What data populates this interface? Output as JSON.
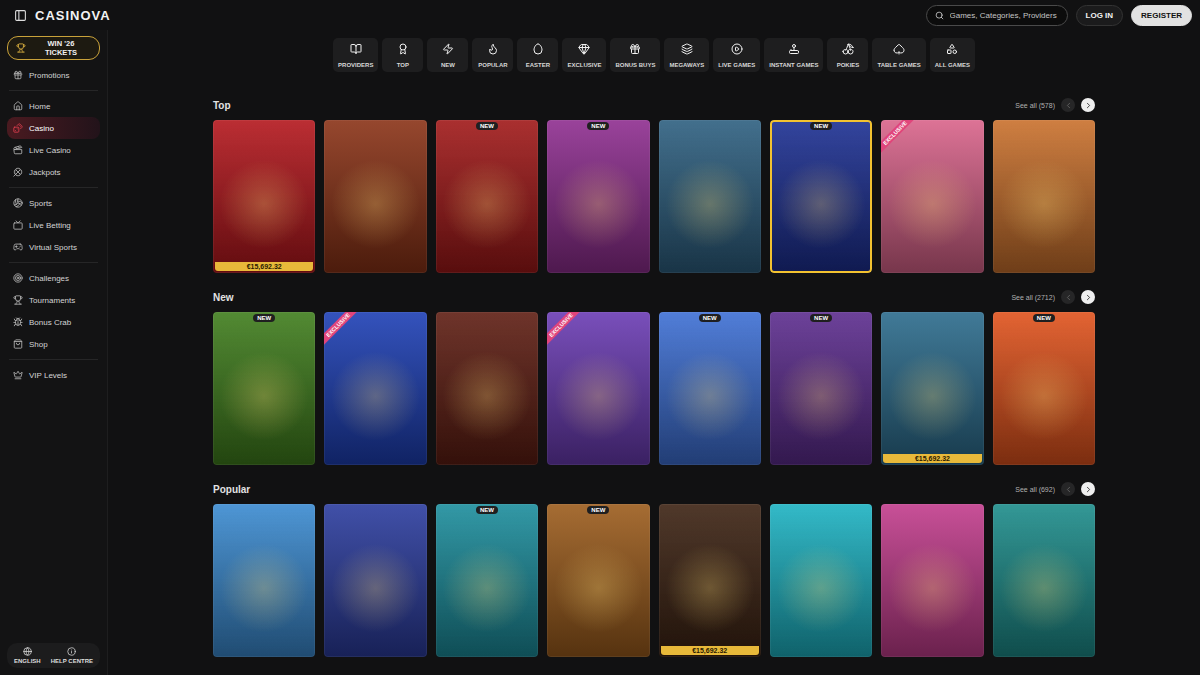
{
  "header": {
    "logo": "CASINOVA",
    "search": {
      "placeholder": "Games, Categories, Providers"
    },
    "buttons": [
      {
        "label": "LOG IN",
        "kind": "secondary"
      },
      {
        "label": "REGISTER",
        "kind": "primary"
      }
    ]
  },
  "sidebar": {
    "promo": "WIN '26 TICKETS",
    "groups": [
      [
        {
          "label": "Promotions",
          "selected": false
        }
      ],
      [
        {
          "label": "Home",
          "selected": false
        },
        {
          "label": "Casino",
          "selected": true
        },
        {
          "label": "Live Casino",
          "selected": false
        },
        {
          "label": "Jackpots",
          "selected": false
        }
      ],
      [
        {
          "label": "Sports",
          "selected": false
        },
        {
          "label": "Live Betting",
          "selected": false
        },
        {
          "label": "Virtual Sports",
          "selected": false
        }
      ],
      [
        {
          "label": "Challenges",
          "selected": false
        },
        {
          "label": "Tournaments",
          "selected": false
        },
        {
          "label": "Bonus Crab",
          "selected": false
        },
        {
          "label": "Shop",
          "selected": false
        }
      ],
      [
        {
          "label": "VIP Levels",
          "selected": false
        }
      ]
    ],
    "footer": [
      "ENGLISH",
      "HELP CENTRE"
    ]
  },
  "categories": [
    {
      "label": "PROVIDERS",
      "selected": false
    },
    {
      "label": "TOP",
      "selected": false
    },
    {
      "label": "NEW",
      "selected": false
    },
    {
      "label": "POPULAR",
      "selected": false
    },
    {
      "label": "EASTER",
      "selected": false
    },
    {
      "label": "EXCLUSIVE",
      "selected": false
    },
    {
      "label": "BONUS BUYS",
      "selected": false
    },
    {
      "label": "MEGAWAYS",
      "selected": false
    },
    {
      "label": "LIVE GAMES",
      "selected": false
    },
    {
      "label": "INSTANT GAMES",
      "selected": false
    },
    {
      "label": "POKIES",
      "selected": false
    },
    {
      "label": "TABLE GAMES",
      "selected": false
    },
    {
      "label": "ALL GAMES",
      "selected": false
    }
  ],
  "sections": [
    {
      "title": "Top",
      "see_all": "See all (578)",
      "prev_enabled": false,
      "next_enabled": true,
      "games": [
        {
          "color": "#b3161c",
          "selected": false,
          "badges": [
            {
              "kind": "jackpot",
              "text": "€15,692.32"
            }
          ]
        },
        {
          "color": "#8a3216",
          "selected": false,
          "badges": []
        },
        {
          "color": "#a01818",
          "selected": false,
          "badges": [
            {
              "kind": "new",
              "text": "NEW"
            }
          ]
        },
        {
          "color": "#8e2d8f",
          "selected": false,
          "badges": [
            {
              "kind": "new",
              "text": "NEW"
            }
          ]
        },
        {
          "color": "#2d5f80",
          "selected": false,
          "badges": []
        },
        {
          "color": "#1c2f92",
          "selected": true,
          "badges": [
            {
              "kind": "new",
              "text": "NEW"
            }
          ]
        },
        {
          "color": "#d9638a",
          "selected": false,
          "badges": [
            {
              "kind": "exclusive",
              "text": "EXCLUSIVE"
            }
          ]
        },
        {
          "color": "#c9702c",
          "selected": false,
          "badges": []
        }
      ]
    },
    {
      "title": "New",
      "see_all": "See all (2712)",
      "prev_enabled": false,
      "next_enabled": true,
      "games": [
        {
          "color": "#3f7d1c",
          "selected": false,
          "badges": [
            {
              "kind": "new",
              "text": "NEW"
            }
          ]
        },
        {
          "color": "#1d3fb5",
          "selected": false,
          "badges": [
            {
              "kind": "exclusive",
              "text": "EXCLUSIVE"
            }
          ]
        },
        {
          "color": "#5e1d12",
          "selected": false,
          "badges": []
        },
        {
          "color": "#6a3bb3",
          "selected": false,
          "badges": [
            {
              "kind": "exclusive",
              "text": "EXCLUSIVE"
            }
          ]
        },
        {
          "color": "#3d6fd4",
          "selected": false,
          "badges": [
            {
              "kind": "new",
              "text": "NEW"
            }
          ]
        },
        {
          "color": "#5c2c8e",
          "selected": false,
          "badges": [
            {
              "kind": "new",
              "text": "NEW"
            }
          ]
        },
        {
          "color": "#2b6b8c",
          "selected": false,
          "badges": [
            {
              "kind": "jackpot",
              "text": "€15,692.32"
            }
          ]
        },
        {
          "color": "#e0521c",
          "selected": false,
          "badges": [
            {
              "kind": "new",
              "text": "NEW"
            }
          ]
        }
      ]
    },
    {
      "title": "Popular",
      "see_all": "See all (692)",
      "prev_enabled": false,
      "next_enabled": true,
      "games": [
        {
          "color": "#3a8ad0",
          "selected": false,
          "badges": []
        },
        {
          "color": "#2b3c9e",
          "selected": false,
          "badges": []
        },
        {
          "color": "#1b8d9c",
          "selected": false,
          "badges": [
            {
              "kind": "new",
              "text": "NEW"
            }
          ]
        },
        {
          "color": "#9c5c1c",
          "selected": false,
          "badges": [
            {
              "kind": "new",
              "text": "NEW"
            }
          ]
        },
        {
          "color": "#3c2212",
          "selected": false,
          "badges": [
            {
              "kind": "jackpot",
              "text": "€15,692.32"
            }
          ]
        },
        {
          "color": "#1cb2c2",
          "selected": false,
          "badges": []
        },
        {
          "color": "#c23c8c",
          "selected": false,
          "badges": []
        },
        {
          "color": "#1c8c8a",
          "selected": false,
          "badges": []
        }
      ]
    }
  ]
}
